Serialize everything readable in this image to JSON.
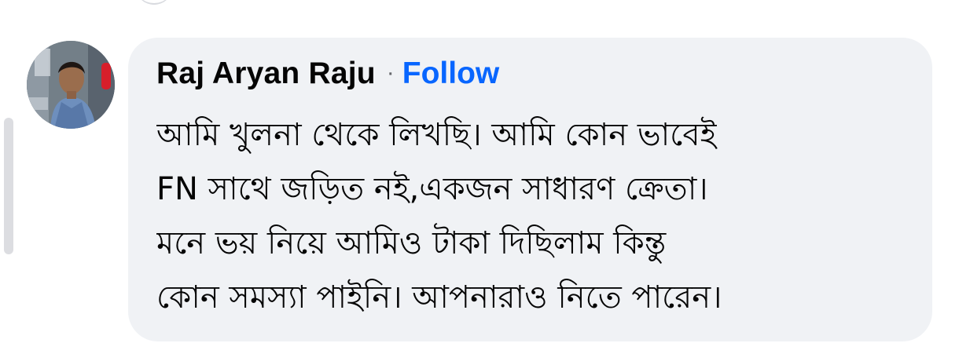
{
  "comment": {
    "author_name": "Raj Aryan Raju",
    "separator": "·",
    "follow_label": "Follow",
    "text_lines": [
      "আমি খুলনা থেকে লিখছি। আমি কোন ভাবেই",
      "FN সাথে জড়িত নই,একজন সাধারণ ক্রেতা।",
      "মনে ভয় নিয়ে আমিও টাকা দিছিলাম কিন্তু",
      "কোন সমস্যা পাইনি। আপনারাও নিতে পারেন।"
    ]
  },
  "colors": {
    "bubble_background": "#f0f2f5",
    "link_blue": "#0866ff",
    "text_primary": "#050505",
    "text_secondary": "#65676b",
    "thread_line": "#dcdde1"
  },
  "icons": {
    "avatar": "profile-photo"
  }
}
